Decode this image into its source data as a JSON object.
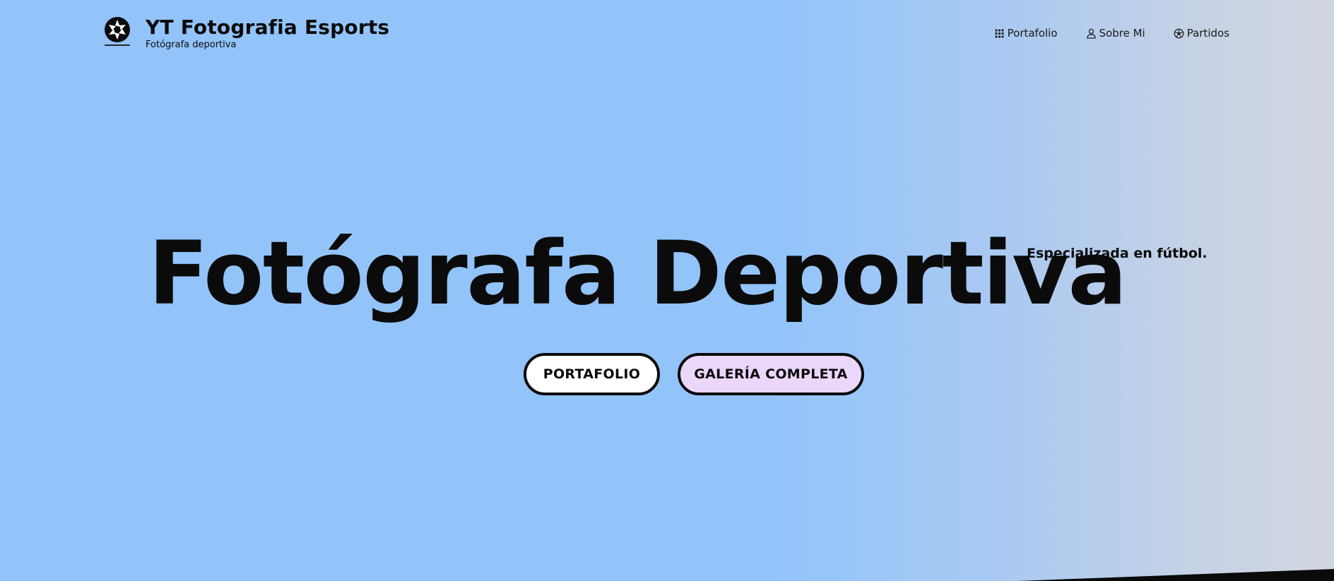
{
  "header": {
    "logo_icon": "camera-aperture-icon",
    "title": "YT Fotografia Esports",
    "subtitle": "Fotógrafa deportiva"
  },
  "nav": {
    "items": [
      {
        "label": "Portafolio",
        "icon": "grid-icon"
      },
      {
        "label": "Sobre Mi",
        "icon": "person-icon"
      },
      {
        "label": "Partidos",
        "icon": "soccer-ball-icon"
      }
    ]
  },
  "hero": {
    "title": "Fotógrafa Deportiva",
    "tagline": "Especializada en fútbol.",
    "buttons": {
      "portafolio": "PORTAFOLIO",
      "galeria": "GALERÍA COMPLETA"
    }
  },
  "colors": {
    "background": "#92c4fa",
    "background_end": "#d2d6df",
    "button_primary": "#ffffff",
    "button_secondary": "#ead7fa",
    "text": "#0b0b0b"
  }
}
